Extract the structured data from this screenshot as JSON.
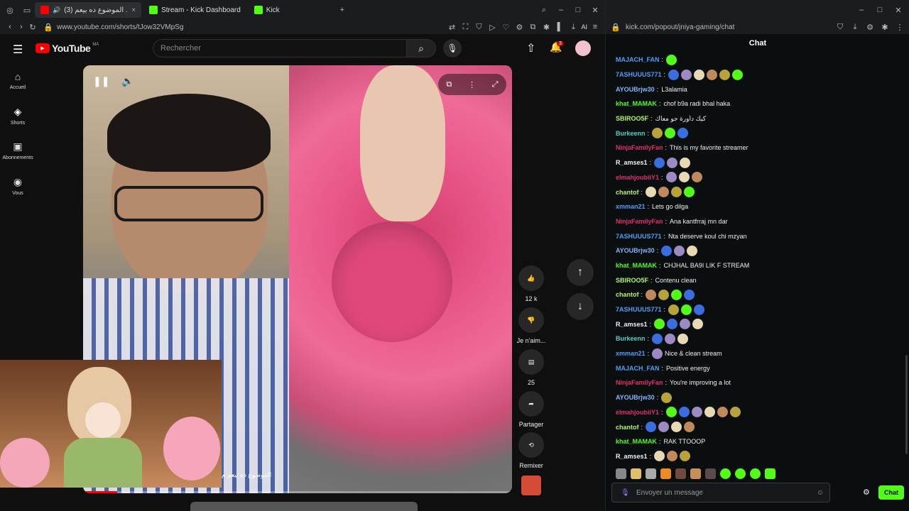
{
  "left_browser": {
    "tabs": [
      {
        "label": "(3) الموضوع ده بيعم ...",
        "icon": "youtube-icon"
      },
      {
        "label": "Stream - Kick Dashboard",
        "icon": "kick-icon"
      },
      {
        "label": "Kick",
        "icon": "kick-icon"
      }
    ],
    "url": "www.youtube.com/shorts/tJow32VMpSg",
    "ai_label": "AI"
  },
  "youtube": {
    "logo": "YouTube",
    "region": "MA",
    "search_placeholder": "Rechercher",
    "notif_count": "3",
    "sidebar": [
      {
        "label": "Accueil",
        "icon": "home-icon"
      },
      {
        "label": "Shorts",
        "icon": "shorts-icon"
      },
      {
        "label": "Abonnements",
        "icon": "subscriptions-icon"
      },
      {
        "label": "Vous",
        "icon": "user-icon"
      }
    ],
    "actions": {
      "like_count": "12 k",
      "dislike_label": "Je n'aim...",
      "comments_count": "25",
      "share_label": "Partager",
      "remix_label": "Remixer"
    },
    "caption": "الموضوع ده بيعم م"
  },
  "right_browser": {
    "url": "kick.com/popout/jniya-gaming/chat"
  },
  "chat": {
    "title": "Chat",
    "messages": [
      {
        "user": "MAJACH_FAN",
        "color": "#4f9df7",
        "text": "",
        "emotes": 1
      },
      {
        "user": "7ASHUUUS771",
        "color": "#4f9df7",
        "text": "",
        "emotes": 6
      },
      {
        "user": "AYOUBrjw30",
        "color": "#7fb6ff",
        "text": "L3alamia",
        "emotes": 0
      },
      {
        "user": "khat_MAMAK",
        "color": "#53fc18",
        "text": "chof b9a radi bhal haka",
        "emotes": 0
      },
      {
        "user": "SBIROO5F",
        "color": "#b5f26b",
        "text": "كيك داورة جو معاك",
        "emotes": 0
      },
      {
        "user": "Burkeenn",
        "color": "#4fd0c7",
        "text": "",
        "emotes": 3
      },
      {
        "user": "NinjaFamilyFan",
        "color": "#e0306b",
        "text": "This is my favorite streamer",
        "emotes": 0
      },
      {
        "user": "R_amses1",
        "color": "#f0f0f0",
        "text": "",
        "emotes": 3
      },
      {
        "user": "elmahjoubiiY1",
        "color": "#e0306b",
        "text": "",
        "emotes": 3
      },
      {
        "user": "chantof",
        "color": "#b5f26b",
        "text": "",
        "emotes": 4
      },
      {
        "user": "xmman21",
        "color": "#4f9df7",
        "text": "Lets go dilga",
        "emotes": 0
      },
      {
        "user": "NinjaFamilyFan",
        "color": "#e0306b",
        "text": "Ana kantfrraj mn dar",
        "emotes": 0
      },
      {
        "user": "7ASHUUUS771",
        "color": "#4f9df7",
        "text": "Nta deserve koul chi mzyan",
        "emotes": 0
      },
      {
        "user": "AYOUBrjw30",
        "color": "#7fb6ff",
        "text": "",
        "emotes": 3
      },
      {
        "user": "khat_MAMAK",
        "color": "#53fc18",
        "text": "CHJHAL BA9I LIK F STREAM",
        "emotes": 0
      },
      {
        "user": "SBIROO5F",
        "color": "#b5f26b",
        "text": "Contenu clean",
        "emotes": 0
      },
      {
        "user": "chantof",
        "color": "#b5f26b",
        "text": "",
        "emotes": 4
      },
      {
        "user": "7ASHUUUS771",
        "color": "#4f9df7",
        "text": "",
        "emotes": 3
      },
      {
        "user": "R_amses1",
        "color": "#f0f0f0",
        "text": "",
        "emotes": 4
      },
      {
        "user": "Burkeenn",
        "color": "#4fd0c7",
        "text": "",
        "emotes": 3
      },
      {
        "user": "xmman21",
        "color": "#4f9df7",
        "text": "Nice & clean stream",
        "emotes": 1
      },
      {
        "user": "MAJACH_FAN",
        "color": "#4f9df7",
        "text": "Positive energy",
        "emotes": 0
      },
      {
        "user": "NinjaFamilyFan",
        "color": "#e0306b",
        "text": "You're improving a lot",
        "emotes": 0
      },
      {
        "user": "AYOUBrjw30",
        "color": "#7fb6ff",
        "text": "",
        "emotes": 1
      },
      {
        "user": "elmahjoubiiY1",
        "color": "#e0306b",
        "text": "",
        "emotes": 6
      },
      {
        "user": "chantof",
        "color": "#b5f26b",
        "text": "",
        "emotes": 4
      },
      {
        "user": "khat_MAMAK",
        "color": "#53fc18",
        "text": "RAK TTOOOP",
        "emotes": 0
      },
      {
        "user": "R_amses1",
        "color": "#f0f0f0",
        "text": "",
        "emotes": 3
      }
    ],
    "input_placeholder": "Envoyer un message",
    "send_label": "Chat",
    "accent": "#53fc18"
  }
}
